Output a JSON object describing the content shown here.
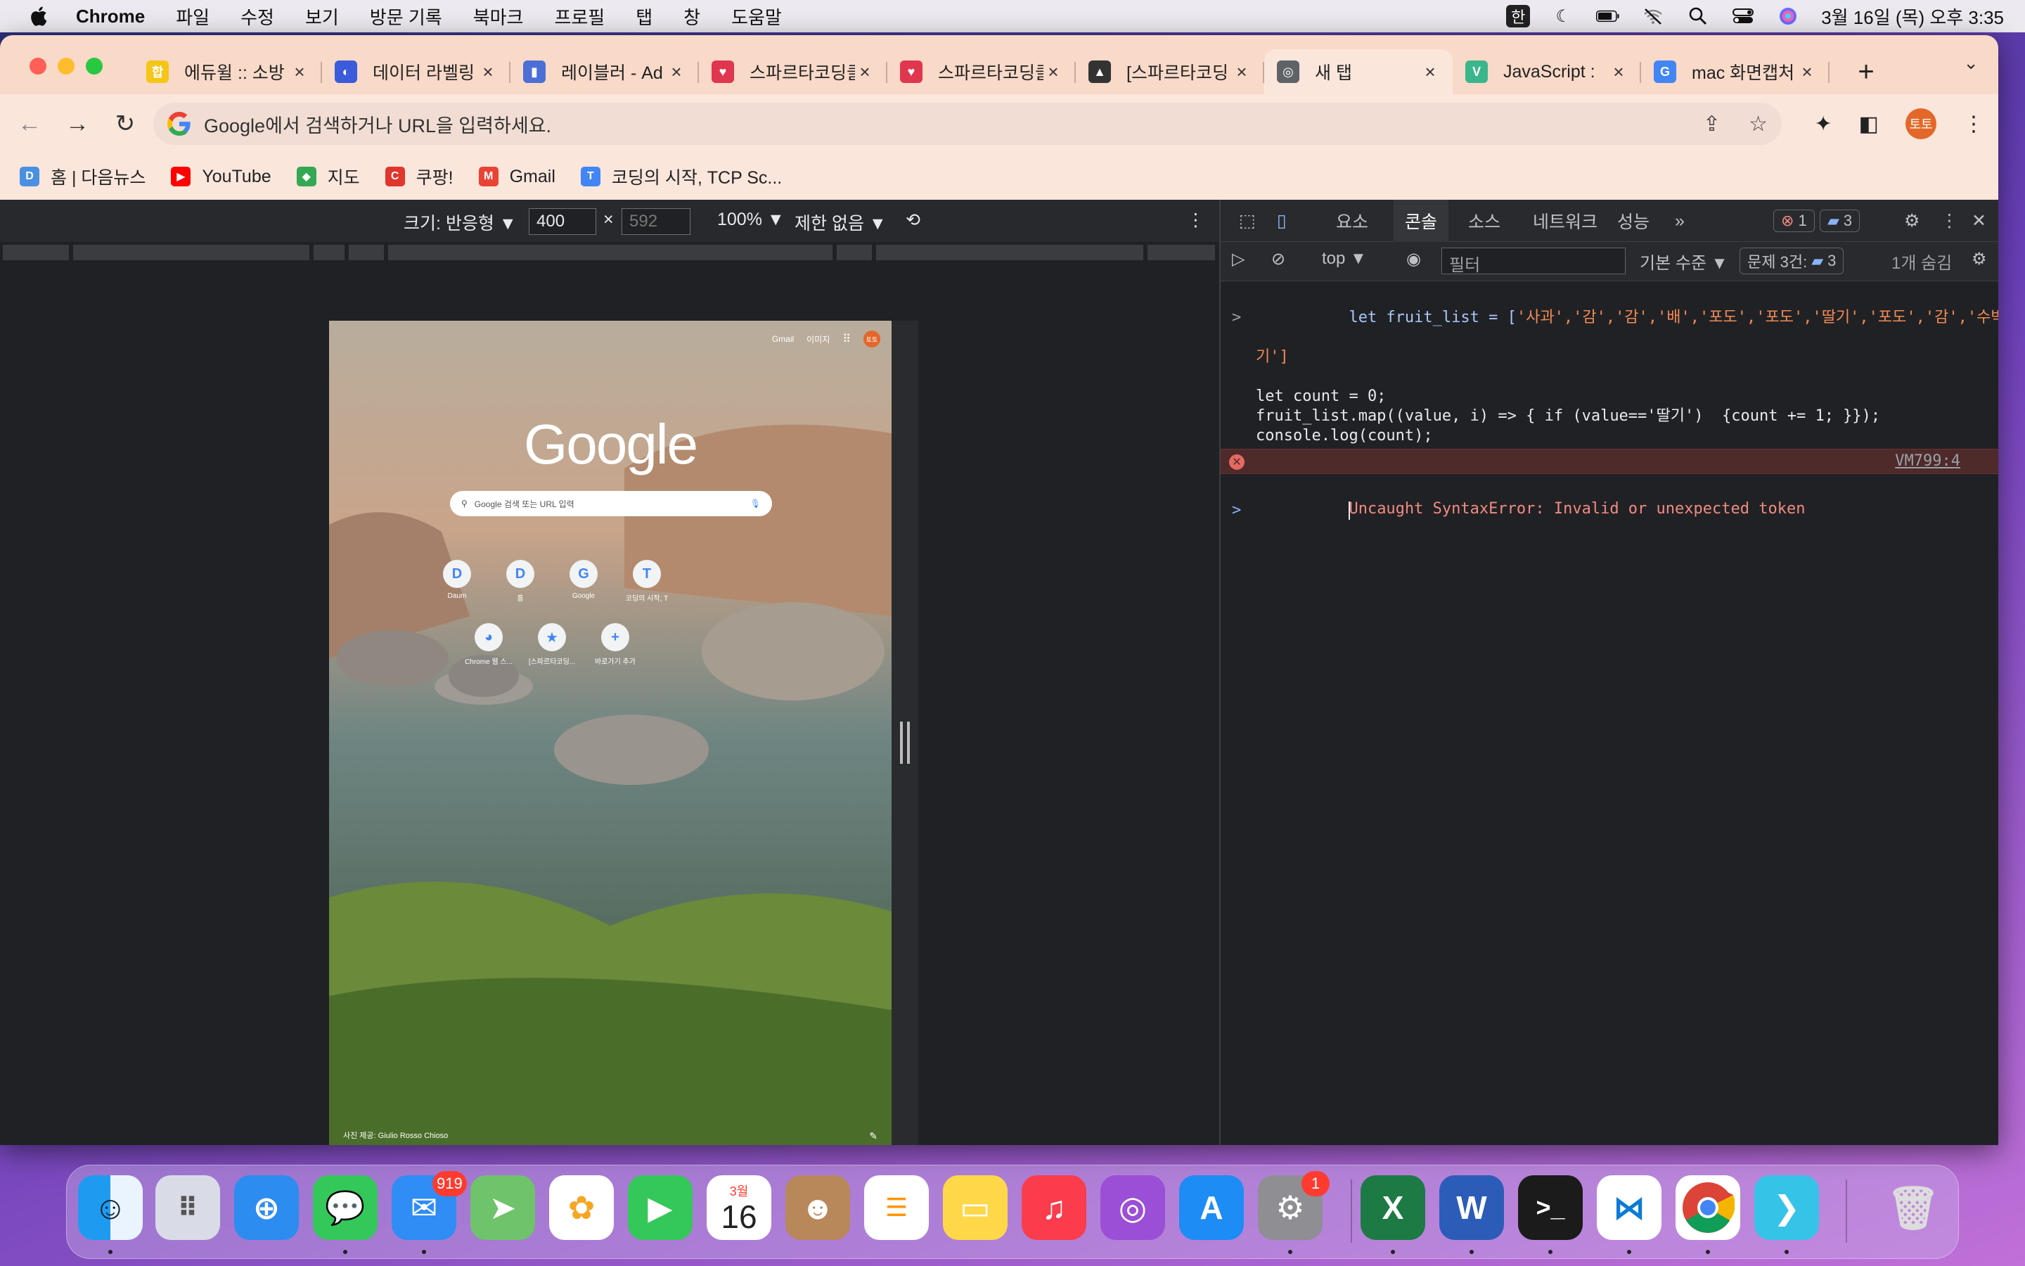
{
  "menubar": {
    "app": "Chrome",
    "items": [
      "파일",
      "수정",
      "보기",
      "방문 기록",
      "북마크",
      "프로필",
      "탭",
      "창",
      "도움말"
    ],
    "ime": "한",
    "datetime": "3월 16일 (목) 오후 3:35"
  },
  "tabs": [
    {
      "label": "에듀윌 :: 소방",
      "color": "#f5c518",
      "glyph": "합"
    },
    {
      "label": "데이터 라벨링",
      "color": "#3b5bdb",
      "glyph": "◐"
    },
    {
      "label": "레이블러 - Ad",
      "color": "#4b6fd6",
      "glyph": "▮"
    },
    {
      "label": "스파르타코딩클",
      "color": "#e0364f",
      "glyph": "♥"
    },
    {
      "label": "스파르타코딩클",
      "color": "#e0364f",
      "glyph": "♥"
    },
    {
      "label": "[스파르타코딩",
      "color": "#333333",
      "glyph": "▲"
    },
    {
      "label": "새 탭",
      "color": "#5f6368",
      "glyph": "◎",
      "active": true
    },
    {
      "label": "JavaScript :",
      "color": "#3bb58c",
      "glyph": "V"
    },
    {
      "label": "mac 화면캡처",
      "color": "#4285f4",
      "glyph": "G"
    }
  ],
  "omnibox": {
    "placeholder": "Google에서 검색하거나 URL을 입력하세요."
  },
  "profile": {
    "initials": "토토"
  },
  "bookmarks": [
    {
      "label": "홈 | 다음뉴스",
      "color": "#4a90e2",
      "glyph": "D"
    },
    {
      "label": "YouTube",
      "color": "#ff0000",
      "glyph": "▶"
    },
    {
      "label": "지도",
      "color": "#34a853",
      "glyph": "◆"
    },
    {
      "label": "쿠팡!",
      "color": "#e0362c",
      "glyph": "C"
    },
    {
      "label": "Gmail",
      "color": "#ea4335",
      "glyph": "M"
    },
    {
      "label": "코딩의 시작, TCP Sc...",
      "color": "#4285f4",
      "glyph": "T"
    }
  ],
  "device_toolbar": {
    "size_label": "크기: 반응형 ▼",
    "width": "400",
    "height_placeholder": "592",
    "times": "×",
    "zoom": "100% ▼",
    "throttle": "제한 없음 ▼"
  },
  "ntp": {
    "top_links": [
      "Gmail",
      "이미지"
    ],
    "avatar": "토토",
    "logo": "Google",
    "search_placeholder": "Google 검색 또는 URL 입력",
    "shortcuts": [
      {
        "label": "Daum",
        "glyph": "D"
      },
      {
        "label": "홈",
        "glyph": "D"
      },
      {
        "label": "Google",
        "glyph": "G"
      },
      {
        "label": "코딩의 시작, T",
        "glyph": "T"
      },
      {
        "label": "Chrome 웹 스...",
        "glyph": "◕"
      },
      {
        "label": "[스파르타코딩...",
        "glyph": "★"
      },
      {
        "label": "바로가기 추가",
        "glyph": "+"
      }
    ],
    "credit": "사진 제공: Giulio Rosso Chioso"
  },
  "devtools": {
    "tabs": [
      "요소",
      "콘솔",
      "소스",
      "네트워크",
      "성능",
      "»"
    ],
    "active_tab": "콘솔",
    "error_count": "1",
    "message_count": "3",
    "context": "top ▼",
    "filter_placeholder": "필터",
    "level": "기본 수준 ▼",
    "issues_label": "문제 3건:",
    "issues_count": "3",
    "hidden": "1개 숨김",
    "console": {
      "line1_a": "let fruit_list = [",
      "line1_items": "'사과','감','감','배','포도','포도','딸기','포도','감','수박','딸",
      "line1_b": "기']",
      "line3": "let count = 0;",
      "line4": "fruit_list.map((value, i) => { if (value=='딸기')  {count += 1; }});",
      "line5": "console.log(count);",
      "error": "Uncaught SyntaxError: Invalid or unexpected token",
      "error_source": "VM799:4"
    }
  },
  "dock": {
    "mail_badge": "919",
    "settings_badge": "1",
    "calendar_month": "3월",
    "calendar_day": "16"
  }
}
